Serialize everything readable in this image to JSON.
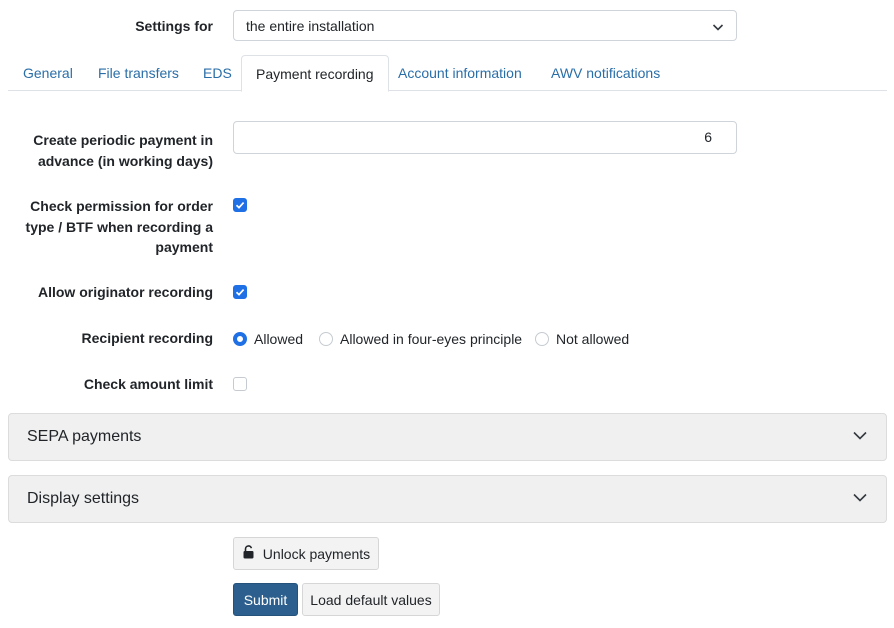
{
  "settings_for": {
    "label": "Settings for",
    "selected": "the entire installation",
    "chevron_icon": "chevron-down-icon"
  },
  "tabs": [
    {
      "label": "General",
      "active": false
    },
    {
      "label": "File transfers",
      "active": false
    },
    {
      "label": "EDS",
      "active": false
    },
    {
      "label": "Payment recording",
      "active": true
    },
    {
      "label": "Account information",
      "active": false
    },
    {
      "label": "AWV notifications",
      "active": false
    }
  ],
  "form": {
    "periodic_payment": {
      "label_line1": "Create periodic payment in",
      "label_line2": "advance (in working days)",
      "value": "6"
    },
    "check_permission": {
      "label_line1": "Check permission for order",
      "label_line2": "type / BTF when recording a",
      "label_line3": "payment",
      "checked": true
    },
    "allow_originator": {
      "label": "Allow originator recording",
      "checked": true
    },
    "recipient_recording": {
      "label": "Recipient recording",
      "options": [
        "Allowed",
        "Allowed in four-eyes principle",
        "Not allowed"
      ],
      "selected": "Allowed"
    },
    "check_amount_limit": {
      "label": "Check amount limit",
      "checked": false
    }
  },
  "accordions": {
    "sepa": "SEPA payments",
    "display": "Display settings"
  },
  "buttons": {
    "unlock": "Unlock payments",
    "submit": "Submit",
    "load_defaults": "Load default values"
  },
  "colors": {
    "accent": "#1f6fe5",
    "tab_link": "#2a6ea8",
    "primary_button": "#2c5f8d"
  }
}
